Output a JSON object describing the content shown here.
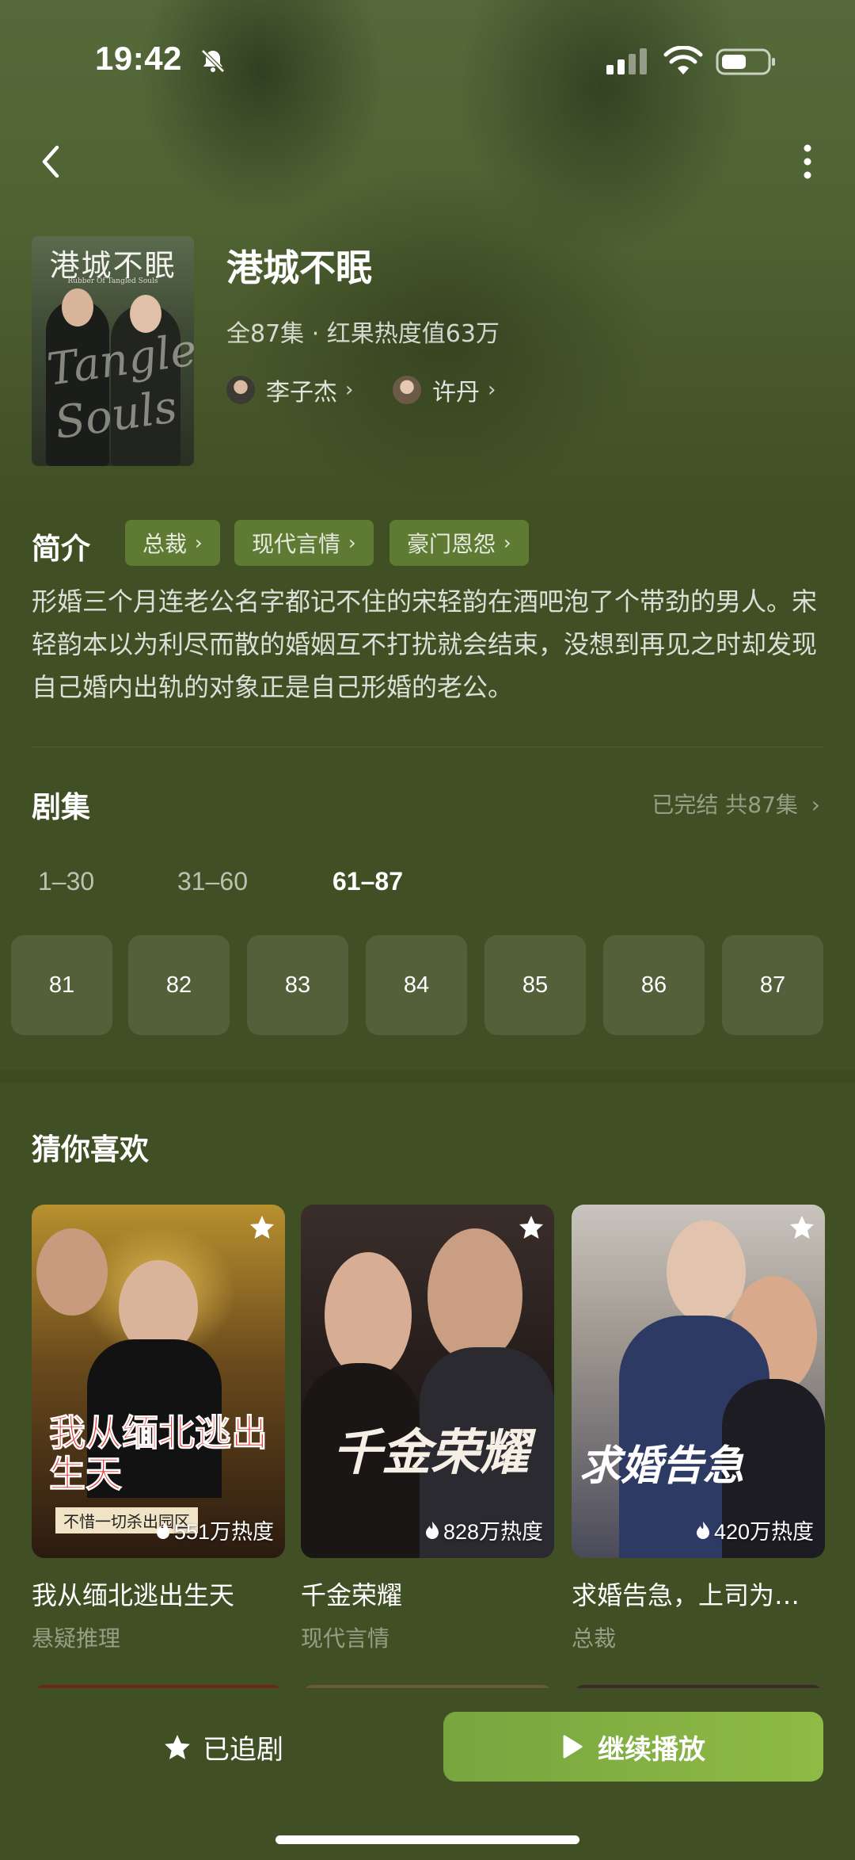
{
  "status_bar": {
    "time": "19:42"
  },
  "drama": {
    "title": "港城不眠",
    "meta": "全87集 · 红果热度值63万",
    "poster_title": "港城不眠",
    "poster_subtitle": "Rubber Of Tangled Souls",
    "poster_script": "Tangled Souls",
    "actors": [
      {
        "name": "李子杰"
      },
      {
        "name": "许丹"
      }
    ]
  },
  "intro": {
    "heading": "简介",
    "tags": [
      "总裁",
      "现代言情",
      "豪门恩怨"
    ],
    "synopsis": "形婚三个月连老公名字都记不住的宋轻韵在酒吧泡了个带劲的男人。宋轻韵本以为利尽而散的婚姻互不打扰就会结束，没想到再见之时却发现自己婚内出轨的对象正是自己形婚的老公。"
  },
  "episodes": {
    "heading": "剧集",
    "status": "已完结 共87集",
    "ranges": [
      "1–30",
      "31–60",
      "61–87"
    ],
    "active_range": "61–87",
    "items": [
      "81",
      "82",
      "83",
      "84",
      "85",
      "86",
      "87"
    ]
  },
  "recommend": {
    "heading": "猜你喜欢",
    "items": [
      {
        "title": "我从缅北逃出生天",
        "genre": "悬疑推理",
        "heat": "551万热度",
        "cover_text": "我从缅北逃出生天",
        "cover_caption": "不惜一切杀出园区"
      },
      {
        "title": "千金荣耀",
        "genre": "现代言情",
        "heat": "828万热度",
        "cover_text": "千金荣耀"
      },
      {
        "title": "求婚告急，上司为…",
        "genre": "总裁",
        "heat": "420万热度",
        "cover_text": "求婚告急"
      }
    ]
  },
  "bottom": {
    "follow_label": "已追剧",
    "play_label": "继续播放"
  },
  "colors": {
    "background": "#414f24",
    "tag_bg": "#5f7a33",
    "play_button": "#8ebb45"
  }
}
